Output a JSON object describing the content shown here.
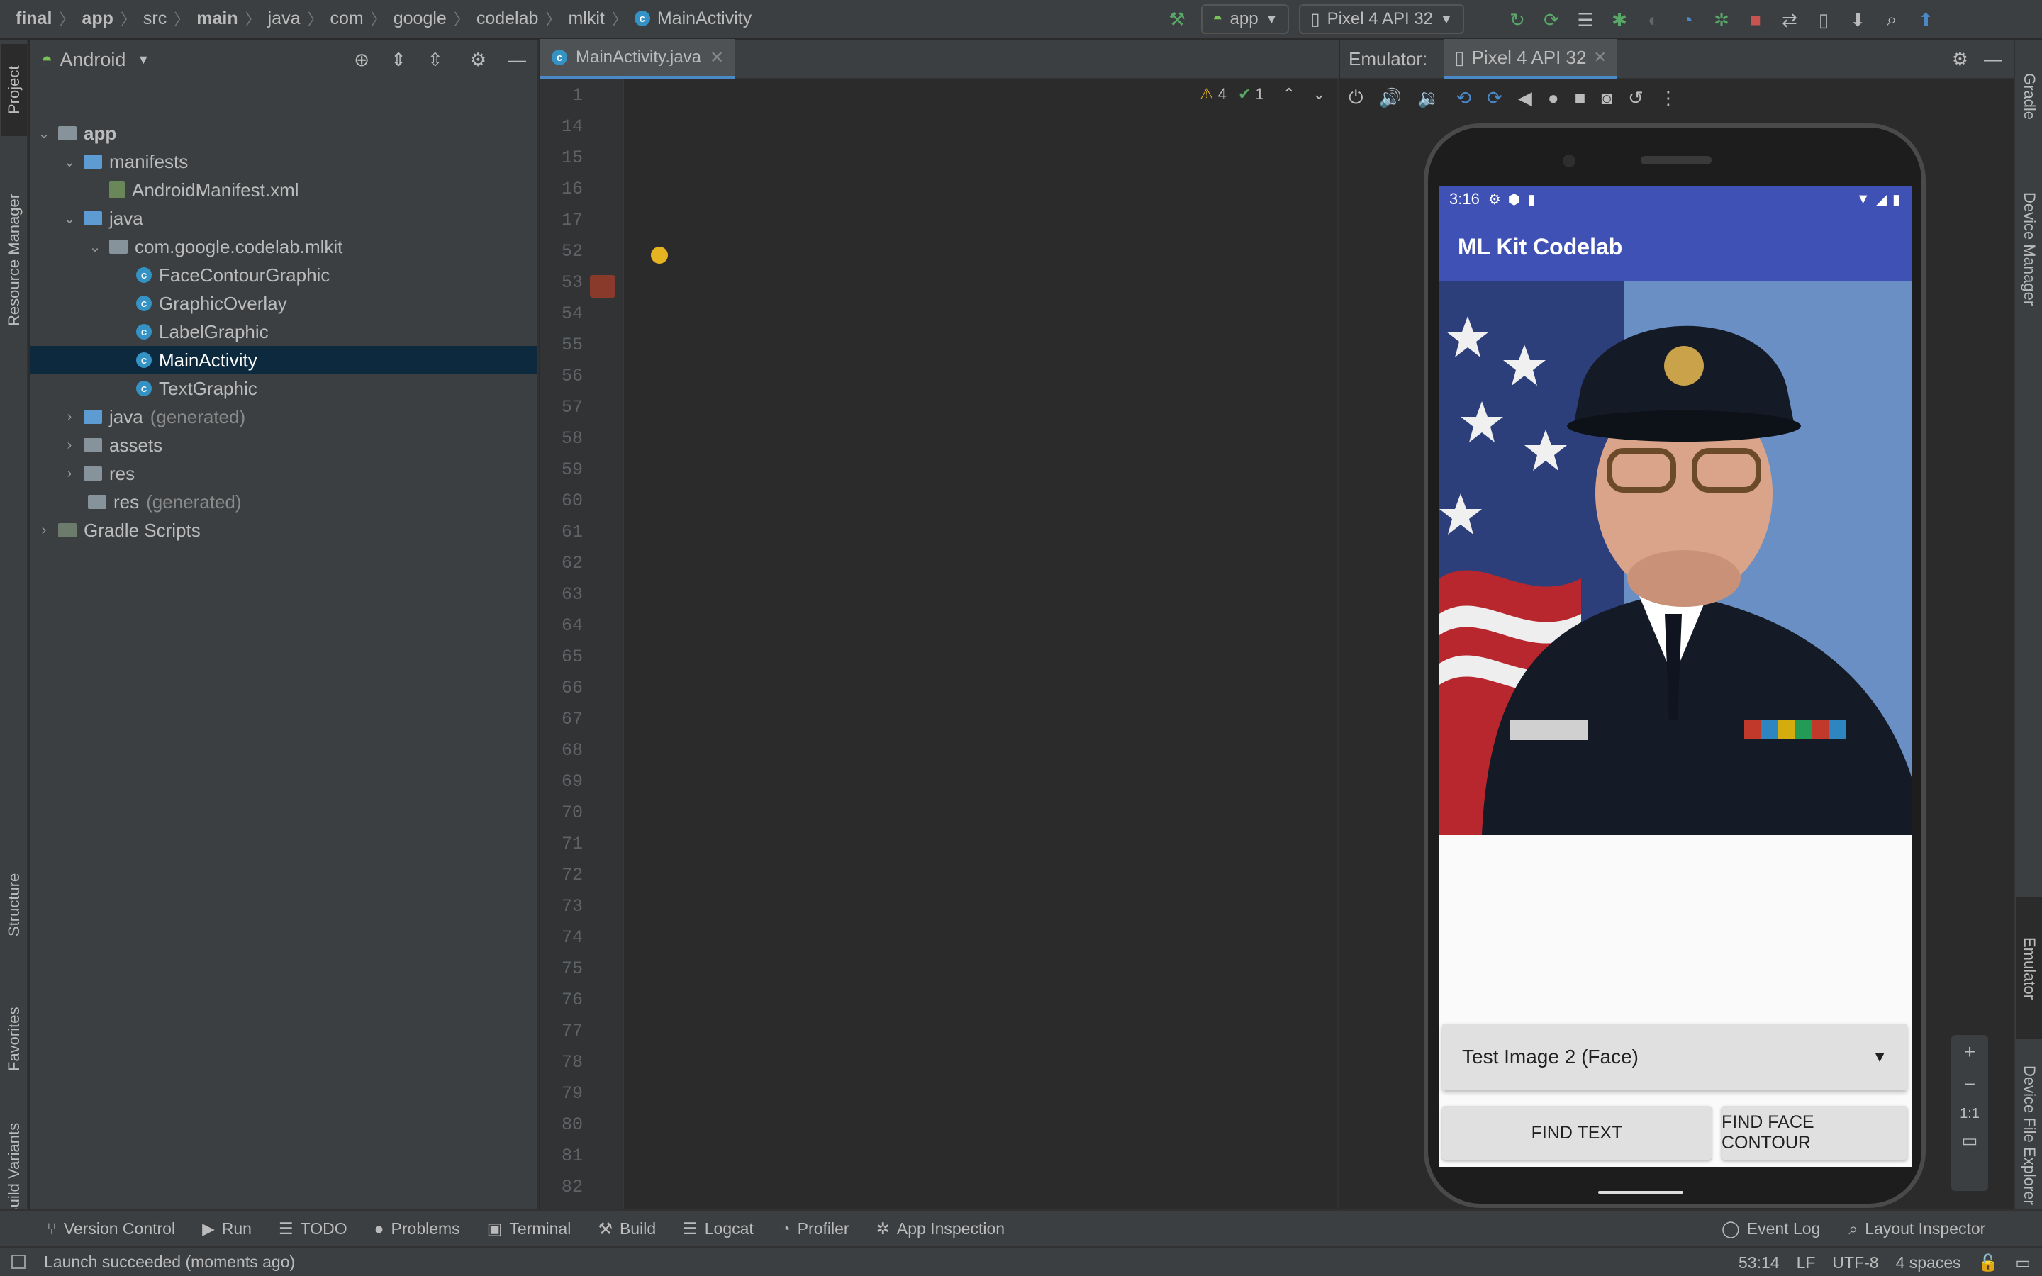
{
  "breadcrumbs": [
    "final",
    "app",
    "src",
    "main",
    "java",
    "com",
    "google",
    "codelab",
    "mlkit",
    "MainActivity"
  ],
  "toolbar": {
    "run_config": "app",
    "device": "Pixel 4 API 32"
  },
  "project_panel": {
    "view_mode": "Android",
    "tree": [
      {
        "label": "app",
        "bold": true
      },
      {
        "label": "manifests"
      },
      {
        "label": "AndroidManifest.xml"
      },
      {
        "label": "java"
      },
      {
        "label": "com.google.codelab.mlkit"
      },
      {
        "label": "FaceContourGraphic"
      },
      {
        "label": "GraphicOverlay"
      },
      {
        "label": "LabelGraphic"
      },
      {
        "label": "MainActivity"
      },
      {
        "label": "TextGraphic"
      },
      {
        "label": "java",
        "suffix": "(generated)"
      },
      {
        "label": "assets"
      },
      {
        "label": "res"
      },
      {
        "label": "res",
        "suffix": "(generated)"
      },
      {
        "label": "Gradle Scripts"
      }
    ]
  },
  "side_tabs_left": [
    "Project",
    "Resource Manager",
    "Structure",
    "Favorites",
    "Build Variants"
  ],
  "side_tabs_right": [
    "Gradle",
    "Device Manager",
    "Emulator",
    "Device File Explorer"
  ],
  "editor": {
    "tab": "MainActivity.java",
    "warnings": "4",
    "weak_warnings": "1",
    "line_numbers": [
      "1",
      "14",
      "15",
      "16",
      "17",
      "52",
      "53",
      "54",
      "55",
      "56",
      "57",
      "58",
      "59",
      "60",
      "61",
      "62",
      "63",
      "64",
      "65",
      "66",
      "67",
      "68",
      "69",
      "70",
      "71",
      "72",
      "73",
      "74",
      "75",
      "76",
      "77",
      "78",
      "79",
      "80",
      "81",
      "82"
    ]
  },
  "emulator": {
    "title": "Emulator:",
    "device_tab": "Pixel 4 API 32",
    "status_time": "3:16",
    "app_title": "ML Kit Codelab",
    "spinner_value": "Test Image 2 (Face)",
    "find_text_label": "FIND TEXT",
    "find_face_label": "FIND FACE CONTOUR",
    "zoom_ratio": "1:1"
  },
  "bottom_tools": [
    "Version Control",
    "Run",
    "TODO",
    "Problems",
    "Terminal",
    "Build",
    "Logcat",
    "Profiler",
    "App Inspection"
  ],
  "bottom_tools_right": [
    "Event Log",
    "Layout Inspector"
  ],
  "status": {
    "message": "Launch succeeded (moments ago)",
    "position": "53:14",
    "line_sep": "LF",
    "encoding": "UTF-8",
    "indent": "4 spaces"
  },
  "colors": {
    "app_primary": "#3f51b5",
    "ide_bg": "#2b2b2b",
    "panel_bg": "#3c3f41",
    "selection": "#0d293e",
    "keyword": "#cc7832",
    "field": "#9876aa",
    "string": "#6a8759"
  }
}
